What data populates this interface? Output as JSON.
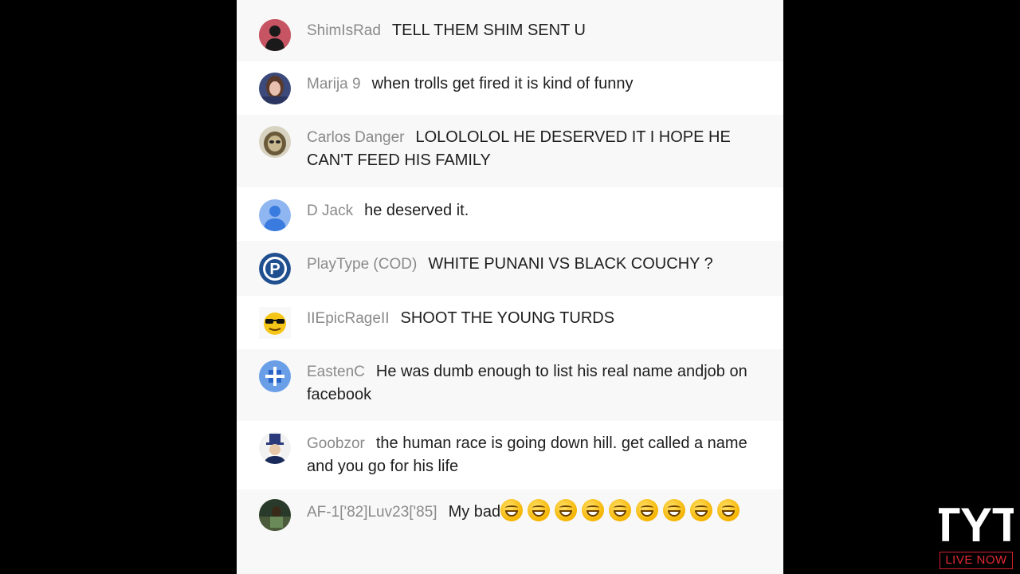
{
  "chat": {
    "messages": [
      {
        "author": "ShimIsRad",
        "text": "TELL THEM SHIM SENT U",
        "avatar": "dark-figure-avatar",
        "emoji_count": 0
      },
      {
        "author": "Marija 9",
        "text": "when trolls get fired it is kind of funny",
        "avatar": "woman-photo-avatar",
        "emoji_count": 0
      },
      {
        "author": "Carlos Danger",
        "text": "LOLOLOLOL HE DESERVED IT I HOPE HE CAN'T FEED HIS FAMILY",
        "avatar": "sloth-avatar",
        "emoji_count": 0
      },
      {
        "author": "D Jack",
        "text": "he deserved it.",
        "avatar": "default-user-avatar",
        "emoji_count": 0
      },
      {
        "author": "PlayType (COD)",
        "text": "WHITE PUNANI VS BLACK COUCHY ?",
        "avatar": "p-logo-avatar",
        "emoji_count": 0
      },
      {
        "author": "IIEpicRageII",
        "text": "SHOOT THE YOUNG TURDS",
        "avatar": "sunglasses-emoji-avatar",
        "emoji_count": 0
      },
      {
        "author": "EastenC",
        "text": "He was dumb enough to list his real name andjob on facebook",
        "avatar": "blue-pattern-avatar",
        "emoji_count": 0
      },
      {
        "author": "Goobzor",
        "text": "the human race is going down hill. get called a name and you go for his life",
        "avatar": "uncle-sam-avatar",
        "emoji_count": 0
      },
      {
        "author": "AF-1['82]Luv23['85]",
        "text": "My bad",
        "avatar": "dark-photo-avatar",
        "emoji_count": 9
      }
    ]
  },
  "branding": {
    "logo_text": "TYT",
    "live_label": "LIVE NOW"
  },
  "colors": {
    "background": "#000000",
    "panel": "#ffffff",
    "author": "#8a8a8a",
    "live_red": "#e52a36"
  }
}
